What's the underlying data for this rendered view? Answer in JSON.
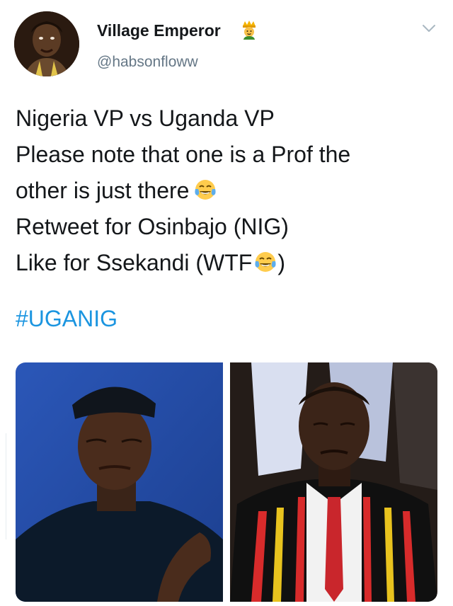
{
  "tweet": {
    "author": {
      "display_name": "Village Emperor",
      "handle": "@habsonfloww",
      "badge_icon": "prince-emoji"
    },
    "text_lines": [
      "Nigeria VP vs Uganda VP",
      "Please note that one is a Prof the",
      "other is just there",
      "Retweet for Osinbajo (NIG)",
      "Like for Ssekandi (WTF",
      ")"
    ],
    "hashtag": "#UGANIG",
    "media": [
      {
        "icon": "photo-man-in-navy-cap-blue-background"
      },
      {
        "icon": "photo-elderly-man-in-striped-blazer"
      }
    ]
  },
  "colors": {
    "text": "#14171a",
    "secondary": "#657786",
    "link": "#1b95e0"
  }
}
